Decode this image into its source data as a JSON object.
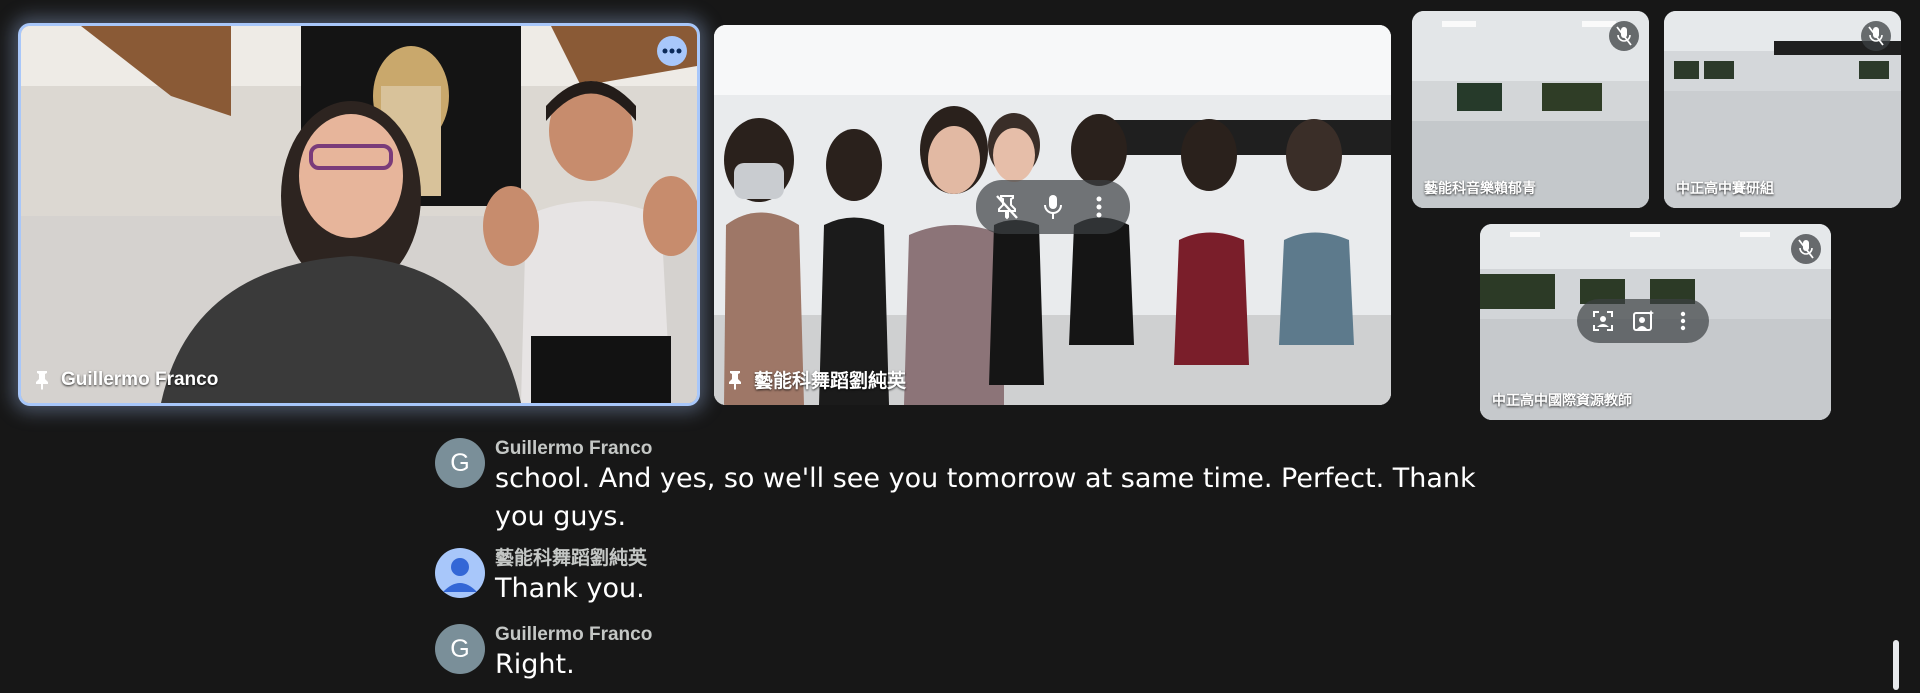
{
  "tiles": [
    {
      "id": "guillermo",
      "name": "Guillermo Franco",
      "pinned": true,
      "active_speaker": true
    },
    {
      "id": "dance-class",
      "name": "藝能科舞蹈劉純英",
      "pinned": true
    },
    {
      "id": "music",
      "name": "藝能科音樂賴郁青",
      "muted": true
    },
    {
      "id": "research",
      "name": "中正高中賽研組",
      "muted": true
    },
    {
      "id": "intl-resource",
      "name": "中正高中國際資源教師",
      "muted": true
    }
  ],
  "captions": [
    {
      "speaker": "Guillermo Franco",
      "initial": "G",
      "text_line1": "school. And yes, so we'll see you tomorrow at same time. Perfect. Thank",
      "text_line2": "you guys."
    },
    {
      "speaker": "藝能科舞蹈劉純英",
      "initial": "",
      "text_line1": "Thank you."
    },
    {
      "speaker": "Guillermo Franco",
      "initial": "G",
      "text_line1": "Right."
    }
  ],
  "icons": {
    "pin": "pin-icon",
    "mute": "mic-off-icon",
    "more": "more-options-icon",
    "framing": "framing-icon",
    "effects": "visual-effects-icon",
    "mic": "mic-icon",
    "pin_off": "unpin-icon"
  },
  "colors": {
    "background": "#171717",
    "active_border": "#a8c7fa",
    "avatar_gray": "#7a8f99"
  }
}
